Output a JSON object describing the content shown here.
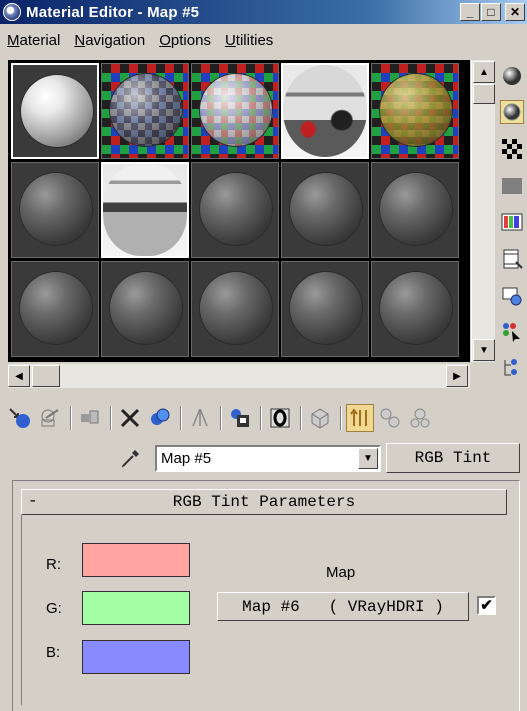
{
  "window": {
    "title": "Material Editor - Map #5",
    "buttons": [
      "_",
      "□",
      "✕"
    ]
  },
  "menu": {
    "items": [
      {
        "label": "Material",
        "accel": "M",
        "rest": "aterial"
      },
      {
        "label": "Navigation",
        "accel": "N",
        "rest": "avigation"
      },
      {
        "label": "Options",
        "accel": "O",
        "rest": "ptions"
      },
      {
        "label": "Utilities",
        "accel": "U",
        "rest": "tilities"
      }
    ]
  },
  "sample_slots": [
    {
      "kind": "white-sphere",
      "active": true
    },
    {
      "kind": "hdri-checker-1"
    },
    {
      "kind": "hdri-checker-2"
    },
    {
      "kind": "photo-sphere",
      "active": true
    },
    {
      "kind": "hdri-checker-3"
    },
    {
      "kind": "gray-sphere"
    },
    {
      "kind": "office-photo-sphere",
      "active": true
    },
    {
      "kind": "gray-sphere"
    },
    {
      "kind": "gray-sphere"
    },
    {
      "kind": "gray-sphere"
    },
    {
      "kind": "gray-sphere"
    },
    {
      "kind": "gray-sphere"
    },
    {
      "kind": "gray-sphere"
    },
    {
      "kind": "gray-sphere"
    },
    {
      "kind": "gray-sphere"
    }
  ],
  "side_toolbar": [
    "sample-type-icon",
    "backlight-icon",
    "background-icon",
    "sample-uv-tiling-icon",
    "video-color-check-icon",
    "make-preview-icon",
    "options-icon",
    "select-by-material-icon",
    "material-navigator-icon"
  ],
  "bottom_toolbar": [
    "get-material-icon",
    "put-to-scene-icon",
    "assign-to-selection-icon",
    "reset-map-icon",
    "make-unique-icon",
    "put-to-library-icon",
    "material-effects-channel-icon",
    "show-map-in-viewport-icon",
    "show-end-result-icon",
    "go-to-parent-icon",
    "go-forward-to-sibling-icon"
  ],
  "map_row": {
    "name": "Map #5",
    "type_button": "RGB Tint"
  },
  "rollout": {
    "collapse_symbol": "-",
    "title": "RGB Tint Parameters",
    "labels": {
      "r": "R:",
      "g": "G:",
      "b": "B:"
    },
    "colors": {
      "r": "#ffa3a3",
      "g": "#a3ffa3",
      "b": "#8a8aff"
    },
    "map_label": "Map",
    "map_button": "Map #6   ( VRayHDRI )",
    "map_enabled_mark": "✔"
  }
}
